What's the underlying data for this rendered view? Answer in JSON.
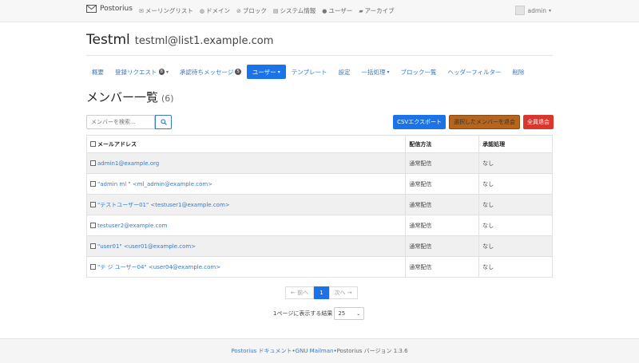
{
  "navbar": {
    "brand": "Postorius",
    "links": [
      {
        "icon": "envelope-icon",
        "glyph": "✉",
        "label": "メーリングリスト"
      },
      {
        "icon": "globe-icon",
        "glyph": "◍",
        "label": "ドメイン"
      },
      {
        "icon": "ban-icon",
        "glyph": "⊘",
        "label": "ブロック"
      },
      {
        "icon": "server-icon",
        "glyph": "▤",
        "label": "システム情報"
      },
      {
        "icon": "user-icon",
        "glyph": "●",
        "label": "ユーザー"
      },
      {
        "icon": "comment-icon",
        "glyph": "▰",
        "label": "アーカイブ"
      }
    ],
    "user": "admin"
  },
  "header": {
    "list_name": "Testml",
    "list_address": "testml@list1.example.com"
  },
  "tabs": [
    {
      "label": "概要",
      "badge": "",
      "dropdown": false,
      "active": false
    },
    {
      "label": "登録リクエスト",
      "badge": "8",
      "dropdown": true,
      "active": false
    },
    {
      "label": "承認待ちメッセージ",
      "badge": "5",
      "dropdown": false,
      "active": false
    },
    {
      "label": "ユーザー",
      "badge": "",
      "dropdown": true,
      "active": true
    },
    {
      "label": "テンプレート",
      "badge": "",
      "dropdown": false,
      "active": false
    },
    {
      "label": "設定",
      "badge": "",
      "dropdown": false,
      "active": false
    },
    {
      "label": "一括処理",
      "badge": "",
      "dropdown": true,
      "active": false
    },
    {
      "label": "ブロック一覧",
      "badge": "",
      "dropdown": false,
      "active": false
    },
    {
      "label": "ヘッダーフィルター",
      "badge": "",
      "dropdown": false,
      "active": false
    },
    {
      "label": "削除",
      "badge": "",
      "dropdown": false,
      "active": false
    }
  ],
  "section": {
    "title": "メンバー一覧",
    "count": "(6)"
  },
  "search": {
    "placeholder": "メンバーを検索..."
  },
  "actions": {
    "csv_export": "CSVエクスポート",
    "unsubscribe_selected": "選択したメンバーを退会",
    "unsubscribe_all": "全員退会"
  },
  "table": {
    "headers": [
      "メールアドレス",
      "配信方法",
      "承認処理"
    ],
    "rows": [
      {
        "email": "admin1@example.org",
        "delivery": "通常配信",
        "moderation": "なし"
      },
      {
        "email": "\"admin ml \" <ml_admin@example.com>",
        "delivery": "通常配信",
        "moderation": "なし"
      },
      {
        "email": "\"テストユーザー01\" <testuser1@example.com>",
        "delivery": "通常配信",
        "moderation": "なし"
      },
      {
        "email": "testuser2@example.com",
        "delivery": "通常配信",
        "moderation": "なし"
      },
      {
        "email": "\"user01\" <user01@example.com>",
        "delivery": "通常配信",
        "moderation": "なし"
      },
      {
        "email": "\"テ ジ ユーザー04\" <user04@example.com>",
        "delivery": "通常配信",
        "moderation": "なし"
      }
    ]
  },
  "pagination": {
    "prev": "← 前へ",
    "current": "1",
    "next": "次へ →"
  },
  "per_page": {
    "label": "1ページに表示する結果",
    "value": "25"
  },
  "footer": {
    "docs_link": "Postorius ドキュメント",
    "sep1": " • ",
    "mailman_link": "GNU Mailman",
    "sep2": " • ",
    "version": "Postorius バージョン 1.3.6"
  }
}
